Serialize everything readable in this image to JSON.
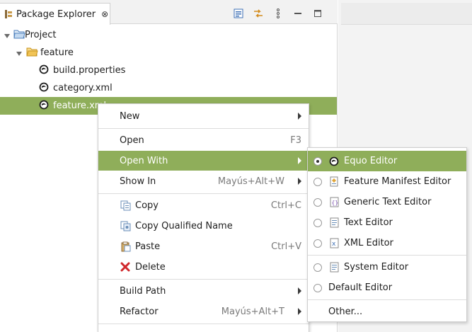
{
  "view": {
    "tab_title": "Package Explorer",
    "close_glyph": "⊗",
    "toolbar_icons": [
      "collapse-all-icon",
      "link-with-editor-icon",
      "view-menu-icon",
      "minimize-icon",
      "maximize-icon"
    ]
  },
  "tree": {
    "items": [
      {
        "label": "Project",
        "icon": "project-folder-icon",
        "expanded": true
      },
      {
        "label": "feature",
        "icon": "folder-icon",
        "expanded": true
      },
      {
        "label": "build.properties",
        "icon": "equo-file-icon"
      },
      {
        "label": "category.xml",
        "icon": "equo-file-icon"
      },
      {
        "label": "feature.xml",
        "icon": "equo-file-icon",
        "selected": true
      }
    ]
  },
  "context_menu": {
    "new_label": "New",
    "open_label": "Open",
    "open_shortcut": "F3",
    "open_with_label": "Open With",
    "show_in_label": "Show In",
    "show_in_shortcut": "Mayús+Alt+W",
    "copy_label": "Copy",
    "copy_shortcut": "Ctrl+C",
    "copy_qualified_label": "Copy Qualified Name",
    "paste_label": "Paste",
    "paste_shortcut": "Ctrl+V",
    "delete_label": "Delete",
    "build_path_label": "Build Path",
    "refactor_label": "Refactor",
    "refactor_shortcut": "Mayús+Alt+T"
  },
  "open_with_menu": {
    "items": [
      {
        "label": "Equo Editor",
        "icon": "equo-icon",
        "checked": true
      },
      {
        "label": "Feature Manifest Editor",
        "icon": "feature-manifest-icon"
      },
      {
        "label": "Generic Text Editor",
        "icon": "generic-text-icon"
      },
      {
        "label": "Text Editor",
        "icon": "text-file-icon"
      },
      {
        "label": "XML Editor",
        "icon": "xml-file-icon"
      },
      {
        "label": "System Editor",
        "icon": "system-editor-icon"
      },
      {
        "label": "Default Editor",
        "icon": ""
      },
      {
        "label": "Other...",
        "icon": ""
      }
    ]
  },
  "colors": {
    "selection": "#8fae5a",
    "folder": "#e8b34a",
    "project": "#4f81bd"
  }
}
